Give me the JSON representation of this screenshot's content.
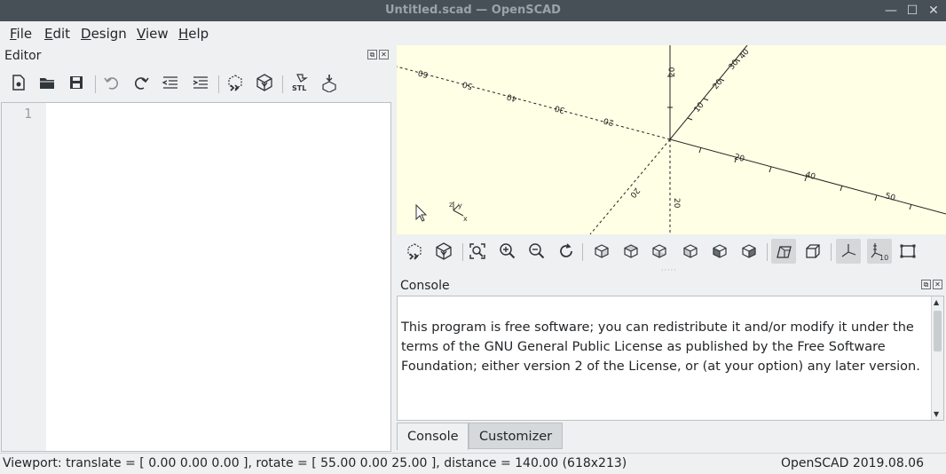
{
  "window": {
    "title": "Untitled.scad — OpenSCAD",
    "controls": {
      "minimize": "—",
      "maximize": "☐",
      "close": "✕"
    }
  },
  "menu": {
    "items": [
      {
        "label": "File",
        "key": "F",
        "rest": "ile"
      },
      {
        "label": "Edit",
        "key": "E",
        "rest": "dit"
      },
      {
        "label": "Design",
        "key": "D",
        "rest": "esign"
      },
      {
        "label": "View",
        "key": "V",
        "rest": "iew"
      },
      {
        "label": "Help",
        "key": "H",
        "rest": "elp"
      }
    ]
  },
  "editor": {
    "title": "Editor",
    "line_numbers": [
      "1"
    ],
    "toolbar_icons": [
      "new-file-icon",
      "open-file-icon",
      "save-icon",
      "undo-icon",
      "redo-icon",
      "unindent-icon",
      "indent-icon",
      "preview-icon",
      "render-icon",
      "export-stl-icon",
      "send-to-printer-icon"
    ],
    "stl_label": "STL"
  },
  "viewport": {
    "axis_labels": {
      "x_pos": [
        "20",
        "40",
        "50"
      ],
      "x_neg": [
        "20",
        "30",
        "40",
        "50",
        "60"
      ],
      "y_pos": [
        "10",
        "20",
        "30",
        "40"
      ],
      "y_neg": [
        "20"
      ],
      "z_pos": [
        "20"
      ],
      "z_neg": [
        "20"
      ]
    },
    "mini_axes": {
      "x": "x",
      "y": "y",
      "z": "z"
    },
    "toolbar_icons": [
      "preview-icon",
      "render-icon",
      "view-all-icon",
      "zoom-in-icon",
      "zoom-out-icon",
      "reset-view-icon",
      "view-right-icon",
      "view-top-icon",
      "view-bottom-icon",
      "view-left-icon",
      "view-front-icon",
      "view-back-icon",
      "perspective-icon",
      "orthogonal-icon",
      "show-axes-icon",
      "show-scale-markers-icon",
      "show-edges-icon"
    ],
    "scale_marker_label": "10"
  },
  "console": {
    "title": "Console",
    "text": "This program is free software; you can redistribute it and/or modify it under the terms of the GNU General Public License as published by the Free Software Foundation; either version 2 of the License, or (at your option) any later version.",
    "tabs": [
      {
        "label": "Console",
        "active": true
      },
      {
        "label": "Customizer",
        "active": false
      }
    ]
  },
  "status": {
    "viewport": "Viewport: translate = [ 0.00 0.00 0.00 ], rotate = [ 55.00 0.00 25.00 ], distance = 140.00 (618x213)",
    "version": "OpenSCAD 2019.08.06"
  },
  "colors": {
    "viewport_bg": "#ffffe5",
    "title_bg": "#475057",
    "window_bg": "#eff0f1"
  }
}
